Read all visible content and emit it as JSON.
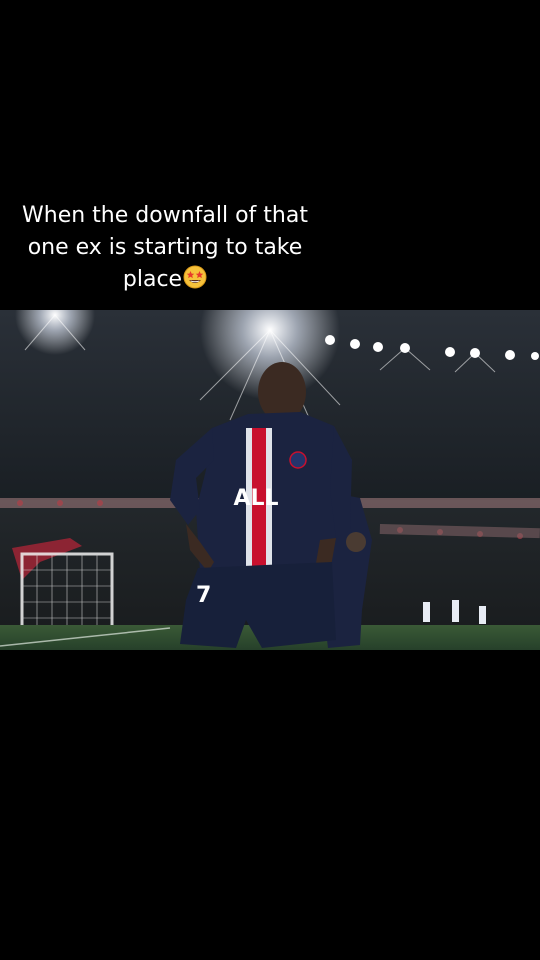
{
  "caption": {
    "line1": "When the downfall of that",
    "line2": "one ex is starting to take",
    "line3": "place",
    "emoji": "star-struck-emoji"
  },
  "video_frame": {
    "jersey_sponsor": "ALL",
    "jersey_number": "7",
    "colors": {
      "background": "#000000",
      "pitch": "#2e4a2c",
      "jersey": "#1b2340",
      "stripe_red": "#c8102e"
    }
  }
}
